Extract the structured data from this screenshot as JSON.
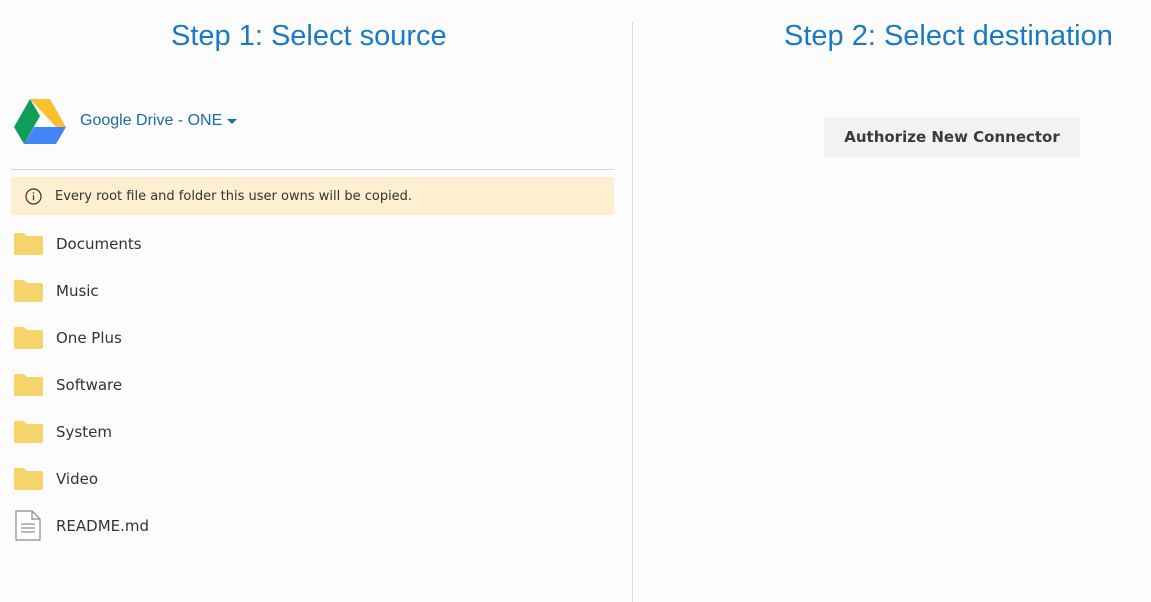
{
  "source": {
    "title": "Step 1: Select source",
    "account_label": "Google Drive - ONE",
    "logo_icon": "google-drive-icon",
    "notice": {
      "icon": "info-icon",
      "text": "Every root file and folder this user owns will be copied.",
      "background": "#fdefcf"
    },
    "items": [
      {
        "name": "Documents",
        "type": "folder",
        "icon": "folder-icon"
      },
      {
        "name": "Music",
        "type": "folder",
        "icon": "folder-icon"
      },
      {
        "name": "One Plus",
        "type": "folder",
        "icon": "folder-icon"
      },
      {
        "name": "Software",
        "type": "folder",
        "icon": "folder-icon"
      },
      {
        "name": "System",
        "type": "folder",
        "icon": "folder-icon"
      },
      {
        "name": "Video",
        "type": "folder",
        "icon": "folder-icon"
      },
      {
        "name": "README.md",
        "type": "file",
        "icon": "document-icon"
      }
    ]
  },
  "destination": {
    "title": "Step 2: Select destination",
    "authorize_label": "Authorize New Connector"
  },
  "colors": {
    "accent": "#1a7ac2",
    "folder": "#f5d46b",
    "notice_bg": "#fdefcf"
  }
}
